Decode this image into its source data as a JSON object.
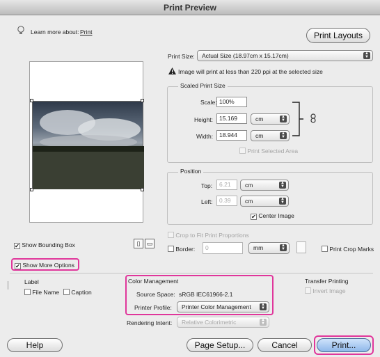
{
  "window": {
    "title": "Print Preview"
  },
  "header": {
    "learn_more": "Learn more about:",
    "learn_link": "Print",
    "print_layouts": "Print Layouts"
  },
  "print_size": {
    "label": "Print Size:",
    "value": "Actual Size (18.97cm x 15.17cm)",
    "warning": "Image will print at less than 220 ppi at the selected size"
  },
  "scaled": {
    "title": "Scaled Print Size",
    "scale_label": "Scale:",
    "scale_value": "100%",
    "height_label": "Height:",
    "height_value": "15.169",
    "height_unit": "cm",
    "width_label": "Width:",
    "width_value": "18.944",
    "width_unit": "cm",
    "print_selected": "Print Selected Area"
  },
  "position": {
    "title": "Position",
    "top_label": "Top:",
    "top_value": "6.21",
    "top_unit": "cm",
    "left_label": "Left:",
    "left_value": "0.39",
    "left_unit": "cm",
    "center_image": "Center Image"
  },
  "crop": {
    "label": "Crop to Fit Print Proportions"
  },
  "border": {
    "label": "Border:",
    "value": "0",
    "unit": "mm",
    "crop_marks": "Print Crop Marks"
  },
  "bounding_box": "Show Bounding Box",
  "more_options": "Show More Options",
  "label_section": {
    "title": "Label",
    "file_name": "File Name",
    "caption": "Caption"
  },
  "color_mgmt": {
    "title": "Color Management",
    "source_label": "Source Space:",
    "source_value": "sRGB IEC61966-2.1",
    "profile_label": "Printer Profile:",
    "profile_value": "Printer Color Management",
    "intent_label": "Rendering Intent:",
    "intent_value": "Relative Colorimetric"
  },
  "transfer": {
    "title": "Transfer Printing",
    "invert": "Invert Image"
  },
  "footer": {
    "help": "Help",
    "page_setup": "Page Setup...",
    "cancel": "Cancel",
    "print": "Print..."
  },
  "colors": {
    "highlight": "#e0369b",
    "window_bg": "#ececec"
  }
}
